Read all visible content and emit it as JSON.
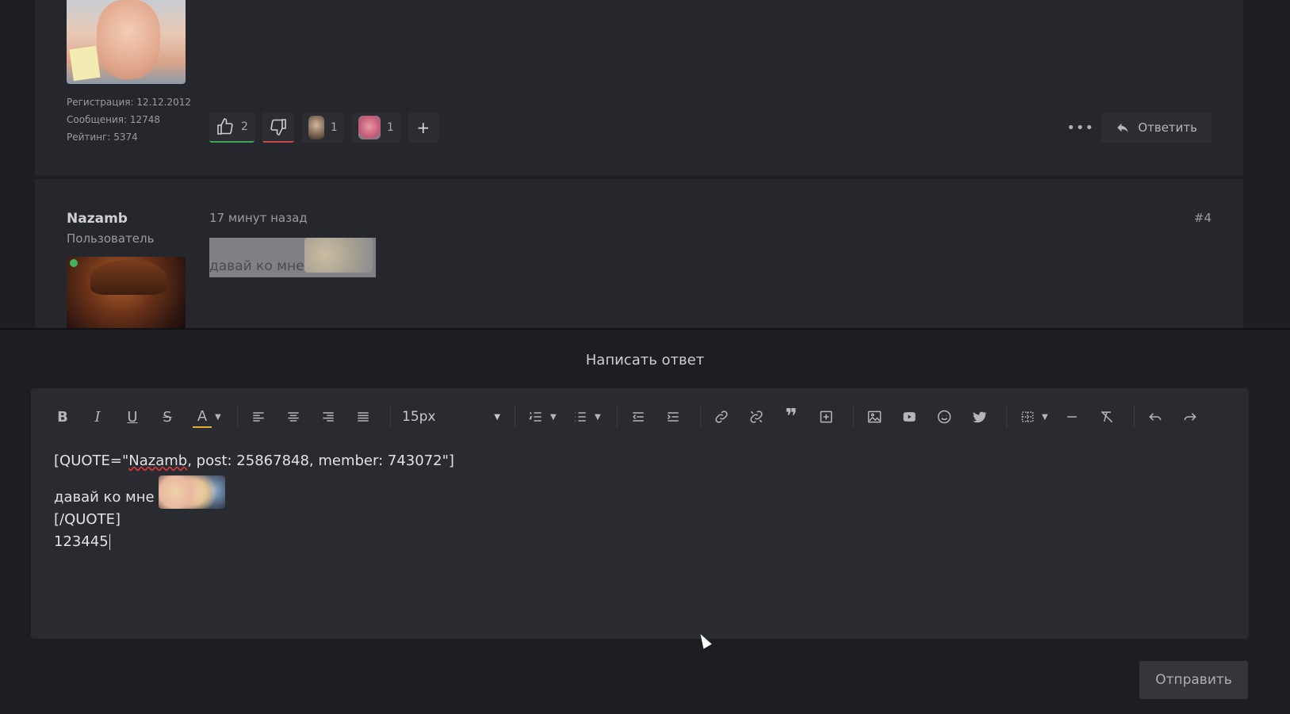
{
  "post1": {
    "stats": {
      "registration": "Регистрация: 12.12.2012",
      "messages": "Сообщения: 12748",
      "rating": "Рейтинг: 5374"
    },
    "reactions": {
      "like_count": "2",
      "emoji1_count": "1",
      "emoji2_count": "1"
    },
    "reply_label": "Ответить",
    "more_label": "•••"
  },
  "post2": {
    "username": "Nazamb",
    "user_title": "Пользователь",
    "time": "17 минут назад",
    "number": "#4",
    "quote_text": "давай ко мне"
  },
  "reply": {
    "title": "Написать ответ",
    "font_size": "15px",
    "send_label": "Отправить",
    "content": {
      "quote_open_prefix": "[QUOTE=\"",
      "quote_author": "Nazamb",
      "quote_open_suffix": ", post: 25867848, member: 743072\"]",
      "quote_body": "давай ко мне",
      "quote_close": "[/QUOTE]",
      "typed": "123445"
    }
  },
  "toolbar_icons": [
    "bold-icon",
    "italic-icon",
    "underline-icon",
    "strikethrough-icon",
    "text-color-icon",
    "align-left-icon",
    "align-center-icon",
    "align-right-icon",
    "align-justify-icon",
    "font-size-select",
    "ordered-list-icon",
    "unordered-list-icon",
    "outdent-icon",
    "indent-icon",
    "link-icon",
    "unlink-icon",
    "quote-icon",
    "insert-icon",
    "image-icon",
    "youtube-icon",
    "emoji-icon",
    "twitter-icon",
    "table-icon",
    "horizontal-rule-icon",
    "clear-format-icon",
    "undo-icon",
    "redo-icon"
  ],
  "colors": {
    "page_bg": "#1c1d21",
    "post_bg": "#26272c",
    "like_green": "#3fa55b",
    "dislike_red": "#c94848",
    "online": "#41b35a"
  }
}
